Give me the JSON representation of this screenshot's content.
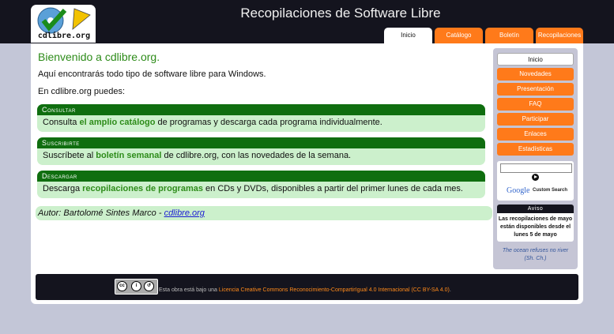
{
  "header": {
    "logo_text": "cdlibre.org",
    "site_title": "Recopilaciones de Software Libre",
    "tabs": [
      {
        "label": "Inicio",
        "active": true
      },
      {
        "label": "Catálogo",
        "active": false
      },
      {
        "label": "Boletín",
        "active": false
      },
      {
        "label": "Recopilaciones",
        "active": false
      }
    ]
  },
  "main": {
    "welcome": "Bienvenido a cdlibre.org.",
    "intro": "Aquí encontrarás todo tipo de software libre para Windows.",
    "can_do": "En cdlibre.org puedes:",
    "boxes": [
      {
        "title": "Consultar",
        "pre": "Consulta ",
        "link": "el amplio catálogo",
        "post": " de programas y descarga cada programa individualmente."
      },
      {
        "title": "Suscribirte",
        "pre": "Suscríbete al ",
        "link": "boletín semanal",
        "post": " de cdlibre.org, con las novedades de la semana."
      },
      {
        "title": "Descargar",
        "pre": "Descarga ",
        "link": "recopilaciones de programas",
        "post": " en CDs y DVDs, disponibles a partir del primer lunes de cada mes."
      }
    ],
    "author_prefix": "Autor: Bartolomé Sintes Marco - ",
    "author_link": "cdlibre.org"
  },
  "sidebar": {
    "items": [
      "Inicio",
      "Novedades",
      "Presentación",
      "FAQ",
      "Participar",
      "Enlaces",
      "Estadísticas"
    ],
    "search_logo": "Google",
    "search_label": "Custom Search",
    "aviso_title": "Aviso",
    "aviso_text": "Las recopilaciones de mayo están disponibles desde el lunes 5 de mayo",
    "quote": "The ocean refuses no river (Sh. Ch.)"
  },
  "footer": {
    "text": "Esta obra está bajo una ",
    "license": "Licencia Creative Commons Reconocimiento-CompartirIgual 4.0 Internacional (CC BY-SA 4.0)",
    "end": "."
  },
  "colors": {
    "accent_orange": "#ff7a1a",
    "green_header": "#0f6e0f",
    "green_bg": "#ccf0cc",
    "dark": "#14141e"
  }
}
